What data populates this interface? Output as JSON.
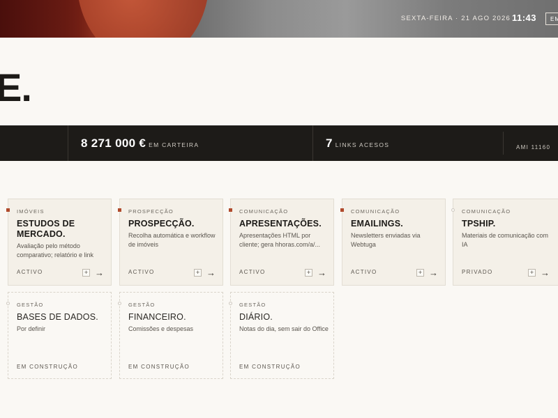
{
  "header": {
    "date": "SEXTA-FEIRA · 21 AGO 2026",
    "time": "11:43",
    "button_label": "EM"
  },
  "hero": {
    "title": "E."
  },
  "stats": [
    {
      "value": "8 271 000 €",
      "label": "EM CARTEIRA"
    },
    {
      "value": "7",
      "label": "LINKS ACESOS"
    }
  ],
  "ami": "AMI 11160",
  "cards": [
    {
      "category": "IMÓVEIS",
      "title": "ESTUDOS DE MERCADO.",
      "description": "Avaliação pelo método comparativo; relatório e link",
      "status": "ACTIVO",
      "plus": "+",
      "arrow": "→"
    },
    {
      "category": "PROSPECÇÃO",
      "title": "PROSPECÇÃO.",
      "description": "Recolha automática e workflow de imóveis",
      "status": "ACTIVO",
      "plus": "+",
      "arrow": "→"
    },
    {
      "category": "COMUNICAÇÃO",
      "title": "APRESENTAÇÕES.",
      "description": "Apresentações HTML por cliente; gera hhoras.com/a/...",
      "status": "ACTIVO",
      "plus": "+",
      "arrow": "→"
    },
    {
      "category": "COMUNICAÇÃO",
      "title": "EMAILINGS.",
      "description": "Newsletters enviadas via Webtuga",
      "status": "ACTIVO",
      "plus": "+",
      "arrow": "→"
    },
    {
      "category": "COMUNICAÇÃO",
      "title": "TPSHIP.",
      "description": "Materiais de comunicação com IA",
      "status": "PRIVADO",
      "plus": "+",
      "arrow": "→"
    },
    {
      "category": "GESTÃO",
      "title": "BASES DE DADOS.",
      "description": "Por definir",
      "status": "EM CONSTRUÇÃO"
    },
    {
      "category": "GESTÃO",
      "title": "FINANCEIRO.",
      "description": "Comissões e despesas",
      "status": "EM CONSTRUÇÃO"
    },
    {
      "category": "GESTÃO",
      "title": "DIÁRIO.",
      "description": "Notas do dia, sem sair do Office",
      "status": "EM CONSTRUÇÃO"
    }
  ],
  "colors": {
    "accent": "#b04a2c",
    "dark": "#1d1b18",
    "background": "#faf8f4",
    "card": "#f4f0e8"
  }
}
